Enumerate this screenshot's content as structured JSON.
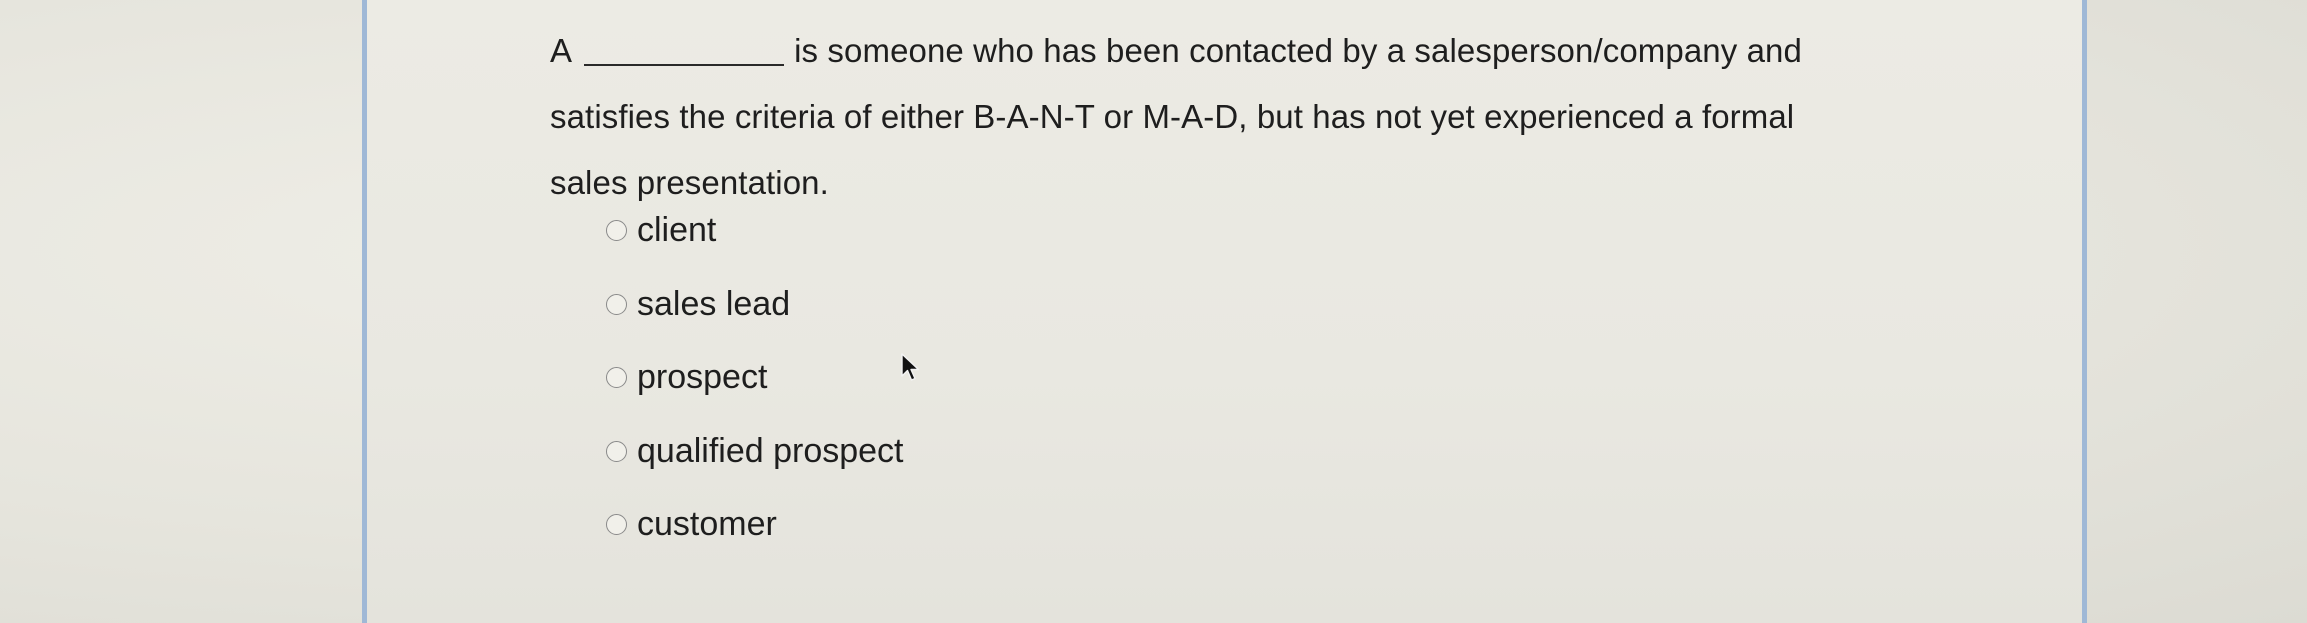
{
  "question": {
    "prefix": "A",
    "text_line1": "is someone who has been contacted by a salesperson/company and",
    "text_line2": "satisfies the criteria of either B-A-N-T or M-A-D, but has not yet experienced a formal",
    "text_line3": "sales presentation."
  },
  "options": [
    {
      "label": "client"
    },
    {
      "label": "sales lead"
    },
    {
      "label": "prospect"
    },
    {
      "label": "qualified prospect"
    },
    {
      "label": "customer"
    }
  ],
  "icons": {
    "cursor": "mouse-pointer-icon",
    "radio": "radio-unchecked-icon"
  }
}
